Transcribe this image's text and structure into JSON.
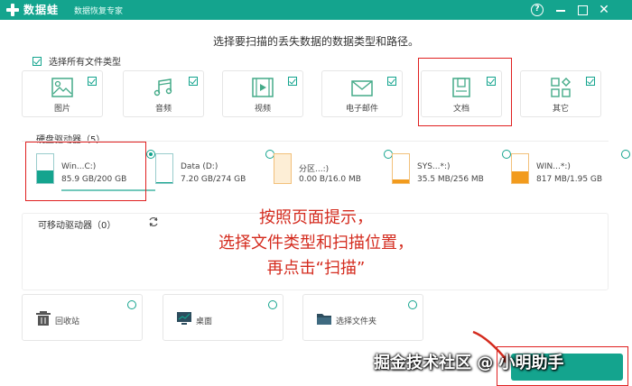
{
  "app": {
    "name": "数据蛙",
    "subtitle": "数据恢复专家"
  },
  "instruction": "选择要扫描的丢失数据的数据类型和路径。",
  "select_all_label": "选择所有文件类型",
  "file_types": [
    {
      "label": "图片",
      "icon": "image-icon",
      "checked": true
    },
    {
      "label": "音频",
      "icon": "music-icon",
      "checked": true
    },
    {
      "label": "视频",
      "icon": "video-icon",
      "checked": true
    },
    {
      "label": "电子邮件",
      "icon": "mail-icon",
      "checked": true
    },
    {
      "label": "文档",
      "icon": "document-icon",
      "checked": true
    },
    {
      "label": "其它",
      "icon": "other-icon",
      "checked": true
    }
  ],
  "hard_drives": {
    "title": "硬盘驱动器（5）",
    "items": [
      {
        "name": "Win...C:)",
        "size": "85.9 GB/200 GB",
        "fill": 0.43,
        "selected": true
      },
      {
        "name": "Data (D:)",
        "size": "7.20 GB/274 GB",
        "fill": 0.03,
        "selected": false
      },
      {
        "name": "分区...:)",
        "size": "0.00  B/16.0 MB",
        "fill": 0.0,
        "selected": false
      },
      {
        "name": "SYS...*:)",
        "size": "35.5 MB/256 MB",
        "fill": 0.14,
        "selected": false
      },
      {
        "name": "WIN...*:)",
        "size": "817 MB/1.95 GB",
        "fill": 0.42,
        "selected": false
      }
    ]
  },
  "removable": {
    "title": "可移动驱动器（0）"
  },
  "locations": [
    {
      "label": "回收站",
      "icon": "recycle-bin-icon"
    },
    {
      "label": "桌面",
      "icon": "desktop-icon"
    },
    {
      "label": "选择文件夹",
      "icon": "folder-icon"
    }
  ],
  "annotation": {
    "line1": "按照页面提示，",
    "line2": "选择文件类型和扫描位置，",
    "line3": "再点击“扫描”"
  },
  "watermark": "掘金技术社区 @ 小明助手",
  "colors": {
    "accent": "#14a48e",
    "annotation": "#d42b1e",
    "orange_drive": "#f29b1d"
  }
}
